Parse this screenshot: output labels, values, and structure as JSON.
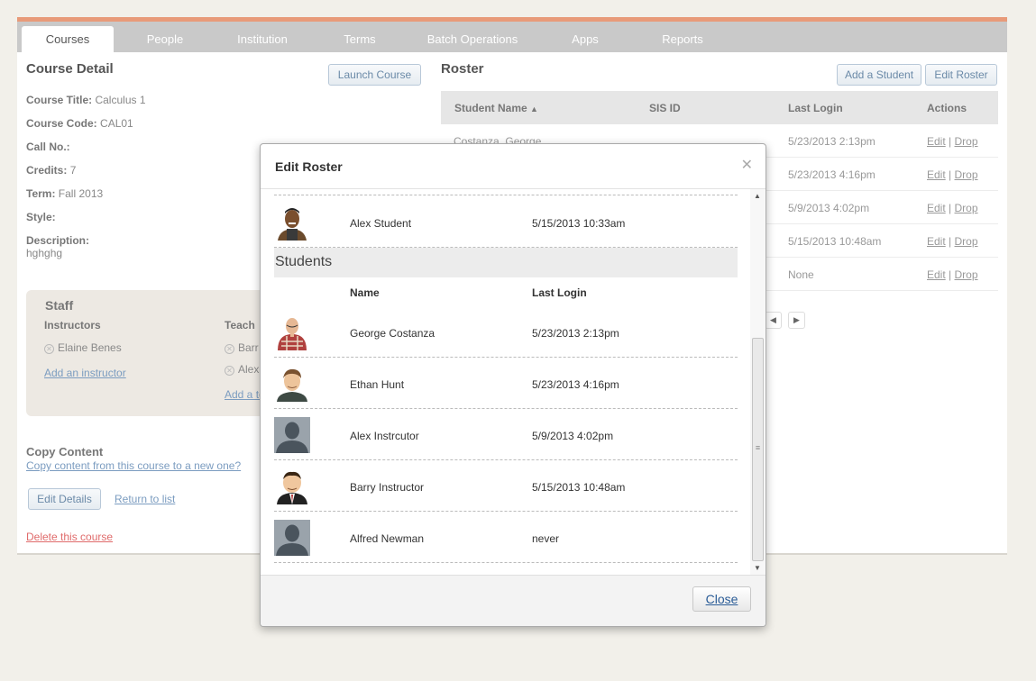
{
  "nav": {
    "tabs": [
      {
        "label": "Courses"
      },
      {
        "label": "People"
      },
      {
        "label": "Institution"
      },
      {
        "label": "Terms"
      },
      {
        "label": "Batch Operations"
      },
      {
        "label": "Apps"
      },
      {
        "label": "Reports"
      }
    ]
  },
  "course_detail": {
    "title": "Course Detail",
    "launch_label": "Launch Course",
    "fields": {
      "course_title": {
        "label": "Course Title:",
        "value": "Calculus 1"
      },
      "course_code": {
        "label": "Course Code:",
        "value": "CAL01"
      },
      "call_no": {
        "label": "Call No.:",
        "value": ""
      },
      "credits": {
        "label": "Credits:",
        "value": "7"
      },
      "term": {
        "label": "Term:",
        "value": "Fall 2013"
      },
      "style": {
        "label": "Style:",
        "value": ""
      },
      "description": {
        "label": "Description:",
        "value": "hghghg"
      }
    },
    "staff": {
      "title": "Staff",
      "instructors_label": "Instructors",
      "instructor": "Elaine Benes",
      "add_instructor": "Add an instructor",
      "teachers_label": "Teach",
      "teacher_1": "Barr",
      "teacher_2": "Alex",
      "add_teacher": "Add a te"
    },
    "copy": {
      "title": "Copy Content",
      "link": "Copy content from this course to a new one?"
    },
    "edit_details": "Edit Details",
    "return_to_list": "Return to list",
    "delete": "Delete this course"
  },
  "roster": {
    "title": "Roster",
    "add_student": "Add a Student",
    "edit_roster": "Edit Roster",
    "columns": {
      "name": "Student Name",
      "sis": "SIS ID",
      "last_login": "Last Login",
      "actions": "Actions"
    },
    "rows": [
      {
        "name": "Costanza, George",
        "last_login": "5/23/2013 2:13pm"
      },
      {
        "name": "",
        "last_login": "5/23/2013 4:16pm"
      },
      {
        "name": "",
        "last_login": "5/9/2013 4:02pm"
      },
      {
        "name": "",
        "last_login": "5/15/2013 10:48am"
      },
      {
        "name": "",
        "last_login": "None"
      }
    ],
    "edit_label": "Edit",
    "drop_label": "Drop",
    "sep": "|"
  },
  "modal": {
    "title": "Edit Roster",
    "top_person": {
      "name": "Alex Student",
      "last_login": "5/15/2013 10:33am"
    },
    "section_title": "Students",
    "col_name": "Name",
    "col_last_login": "Last Login",
    "students": [
      {
        "name": "George Costanza",
        "last_login": "5/23/2013 2:13pm",
        "avatar": "george-costanza-avatar"
      },
      {
        "name": "Ethan Hunt",
        "last_login": "5/23/2013 4:16pm",
        "avatar": "ethan-hunt-avatar"
      },
      {
        "name": "Alex Instrcutor",
        "last_login": "5/9/2013 4:02pm",
        "avatar": "default-silhouette-avatar"
      },
      {
        "name": "Barry Instructor",
        "last_login": "5/15/2013 10:48am",
        "avatar": "barry-instructor-avatar"
      },
      {
        "name": "Alfred Newman",
        "last_login": "never",
        "avatar": "default-silhouette-avatar"
      }
    ],
    "close_label": "Close"
  },
  "colors": {
    "accent": "#e89a79",
    "link": "#7b9cc0",
    "danger": "#e06b6b"
  }
}
